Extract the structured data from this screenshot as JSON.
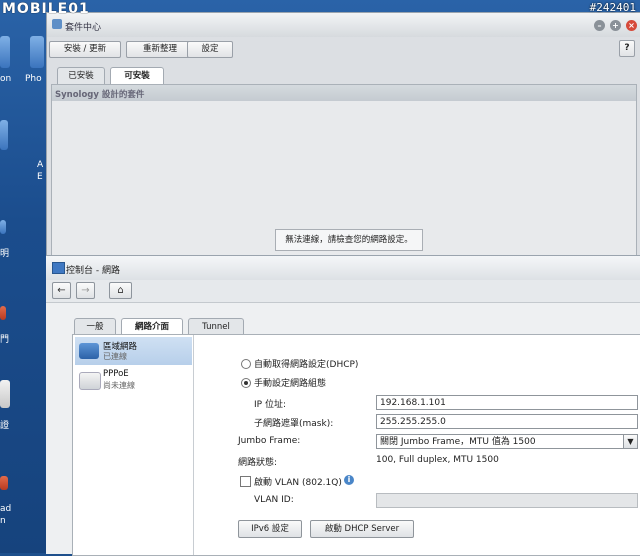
{
  "watermark": {
    "brand": "MOBILE01",
    "photo_id": "#242401"
  },
  "desktop": {
    "labels": [
      "on",
      "Pho",
      "A",
      "E",
      "明",
      "門",
      "證",
      "ad",
      "n"
    ]
  },
  "package_center": {
    "title": "套件中心",
    "toolbar": {
      "install_update": "安裝 / 更新",
      "refresh": "重新整理",
      "settings": "設定",
      "help": "?"
    },
    "tabs": [
      {
        "label": "已安裝"
      },
      {
        "label": "可安裝"
      }
    ],
    "section_header": "Synology 設計的套件",
    "error_message": "無法連線，請檢查您的網路設定。"
  },
  "network": {
    "title": "控制台 - 網路",
    "tabs": [
      {
        "label": "一般"
      },
      {
        "label": "網路介面"
      },
      {
        "label": "Tunnel"
      }
    ],
    "interfaces": [
      {
        "name": "區域網路",
        "status": "已連線"
      },
      {
        "name": "PPPoE",
        "status": "尚未連線"
      }
    ],
    "form": {
      "dhcp_label": "自動取得網路設定(DHCP)",
      "manual_label": "手動設定網路組態",
      "ip_label": "IP 位址:",
      "ip_value": "192.168.1.101",
      "mask_label": "子網路遮罩(mask):",
      "mask_value": "255.255.255.0",
      "jumbo_label": "Jumbo Frame:",
      "jumbo_value": "關閉 Jumbo Frame，MTU 值為 1500",
      "status_label": "網路狀態:",
      "status_value": "100, Full duplex, MTU 1500",
      "vlan_label": "啟動 VLAN (802.1Q)",
      "vlan_id_label": "VLAN ID:",
      "vlan_id_value": "",
      "ipv6_button": "IPv6 設定",
      "dhcp_server_button": "啟動 DHCP Server"
    }
  }
}
